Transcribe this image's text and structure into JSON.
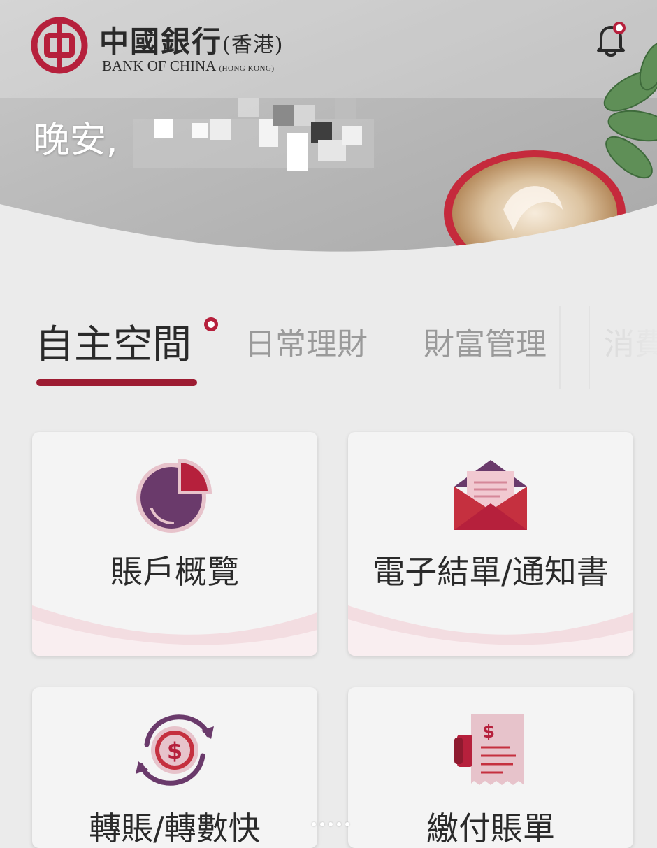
{
  "app": {
    "bank_name_cn": "中國銀行",
    "bank_region_cn": "(香港)",
    "bank_name_en": "BANK OF CHINA",
    "bank_region_en": "(HONG KONG)"
  },
  "hero": {
    "greeting": "晚安,"
  },
  "tabs": [
    {
      "label": "自主空間",
      "active": true,
      "badge": true
    },
    {
      "label": "日常理財",
      "active": false
    },
    {
      "label": "財富管理",
      "active": false
    },
    {
      "label": "消費",
      "active": false
    }
  ],
  "cards": [
    {
      "label": "賬戶概覽",
      "icon": "pie-chart-icon"
    },
    {
      "label": "電子結單/通知書",
      "icon": "envelope-letter-icon"
    },
    {
      "label": "轉賬/轉數快",
      "icon": "dollar-transfer-icon"
    },
    {
      "label": "繳付賬單",
      "icon": "bill-receipt-icon"
    }
  ],
  "colors": {
    "brand_red": "#b6203c",
    "dark_red": "#9d1c32",
    "purple": "#6a3a6b",
    "pink": "#e7c3cb"
  }
}
